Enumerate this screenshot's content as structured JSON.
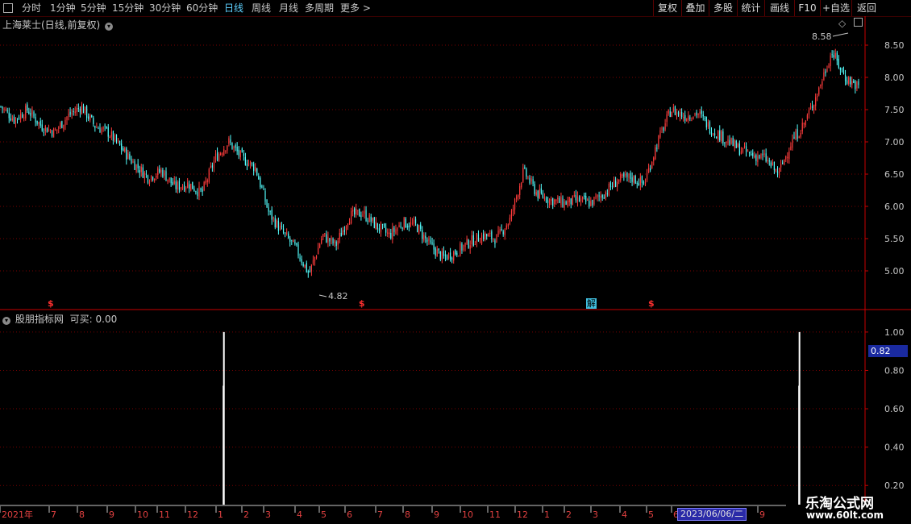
{
  "toolbar": {
    "periods": [
      "分时",
      "1分钟",
      "5分钟",
      "15分钟",
      "30分钟",
      "60分钟",
      "日线",
      "周线",
      "月线",
      "多周期",
      "更多 >"
    ],
    "active_period": "日线",
    "right_buttons": [
      "复权",
      "叠加",
      "多股",
      "统计",
      "画线",
      "F10",
      "+自选",
      "返回"
    ]
  },
  "main_panel": {
    "title": "上海莱士(日线,前复权)",
    "high_label": "8.58",
    "low_label": "4.82",
    "markers": {
      "s": "$",
      "jie": "解"
    }
  },
  "indicator_panel": {
    "title": "股朋指标网",
    "value_label": "可买: 0.00",
    "current_value": "0.82"
  },
  "x_axis": {
    "labels": [
      "2021年",
      "7",
      "8",
      "9",
      "10",
      "11",
      "12",
      "1",
      "2",
      "3",
      "4",
      "5",
      "6",
      "7",
      "8",
      "9",
      "10",
      "11",
      "12",
      "1",
      "2",
      "3",
      "4",
      "5",
      "6",
      "9"
    ],
    "selected_date": "2023/06/06/二"
  },
  "watermark": {
    "title": "乐淘公式网",
    "url": "www.60lt.com"
  },
  "colors": {
    "up": "#ff3c3c",
    "down": "#54ffff",
    "grid": "#7a0000",
    "axis": "#c80000",
    "bg": "#000000"
  },
  "chart_data": [
    {
      "type": "candlestick",
      "title": "上海莱士(日线,前复权)",
      "ylim": [
        4.6,
        8.75
      ],
      "y_ticks": [
        "8.50",
        "8.00",
        "7.50",
        "7.00",
        "6.50",
        "6.00",
        "5.50",
        "5.00"
      ],
      "high": 8.58,
      "low": 4.82,
      "close_path": [
        7.55,
        7.35,
        7.5,
        7.25,
        7.15,
        7.4,
        7.55,
        7.25,
        7.15,
        6.9,
        6.65,
        6.45,
        6.55,
        6.3,
        6.35,
        6.2,
        6.75,
        7.0,
        6.75,
        6.6,
        5.9,
        5.6,
        5.35,
        4.95,
        5.55,
        5.4,
        5.85,
        5.9,
        5.7,
        5.55,
        5.75,
        5.7,
        5.4,
        5.2,
        5.3,
        5.45,
        5.55,
        5.5,
        5.8,
        6.55,
        6.2,
        6.1,
        6.05,
        6.1,
        6.05,
        6.2,
        6.4,
        6.45,
        6.35,
        7.0,
        7.5,
        7.4,
        7.45,
        7.2,
        7.05,
        6.9,
        6.8,
        6.75,
        6.5,
        7.0,
        7.3,
        7.8,
        8.4,
        8.0,
        7.85
      ],
      "s_markers_at": [
        0.055,
        0.415,
        0.75
      ],
      "jie_marker_at": 0.678
    },
    {
      "type": "bar",
      "title": "股朋指标网",
      "ylim": [
        0.1,
        1.05
      ],
      "y_ticks": [
        "1.00",
        "0.80",
        "0.60",
        "0.40",
        "0.20"
      ],
      "signal_value": 1.0,
      "signals_at": [
        0.246,
        0.912
      ]
    }
  ]
}
